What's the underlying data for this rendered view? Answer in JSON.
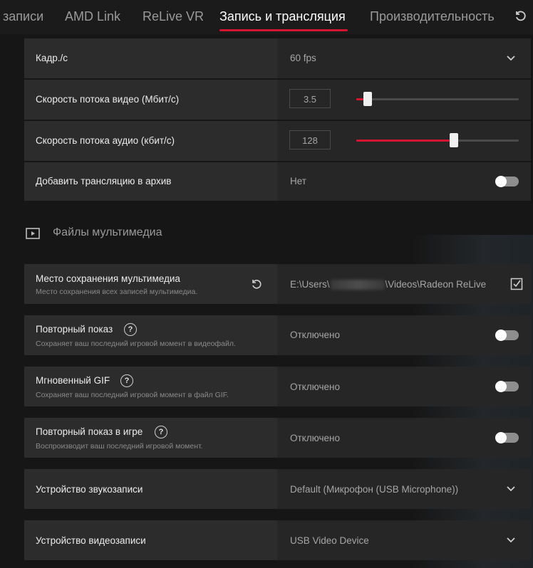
{
  "tabs": [
    {
      "label": "записи",
      "active": false
    },
    {
      "label": "AMD Link",
      "active": false
    },
    {
      "label": "ReLive VR",
      "active": false
    },
    {
      "label": "Запись и трансляция",
      "active": true
    },
    {
      "label": "Производительность",
      "active": false
    }
  ],
  "colors": {
    "accent": "#d5142f",
    "background": "#161616",
    "row_left": "#2c2c2c",
    "row_right": "#262626"
  },
  "rows": {
    "fps": {
      "label": "Кадр./с",
      "value": "60 fps"
    },
    "video_bitrate": {
      "label": "Скорость потока видео (Мбит/с)",
      "value": "3.5",
      "slider_fraction": 0.07
    },
    "audio_bitrate": {
      "label": "Скорость потока аудио (кбит/с)",
      "value": "128",
      "slider_fraction": 0.6
    },
    "archive": {
      "label": "Добавить трансляцию в архив",
      "value": "Нет",
      "enabled": false
    }
  },
  "media_section": {
    "title": "Файлы мультимедиа",
    "icon": "play-icon"
  },
  "media_rows": {
    "save_location": {
      "label": "Место сохранения мультимедиа",
      "sublabel": "Место сохранения всех записей мультимедиа.",
      "path_prefix": "E:\\Users\\",
      "path_suffix": "\\Videos\\Radeon ReLive"
    },
    "instant_replay": {
      "label": "Повторный показ",
      "sublabel": "Сохраняет ваш последний игровой момент в видеофайл.",
      "value": "Отключено",
      "enabled": false
    },
    "instant_gif": {
      "label": "Мгновенный GIF",
      "sublabel": "Сохраняет ваш последний игровой момент в файл GIF.",
      "value": "Отключено",
      "enabled": false
    },
    "in_game_replay": {
      "label": "Повторный показ в игре",
      "sublabel": "Воспроизводит ваш последний игровой момент.",
      "value": "Отключено",
      "enabled": false
    },
    "audio_device": {
      "label": "Устройство звукозаписи",
      "value": "Default (Микрофон (USB Microphone))"
    },
    "video_device": {
      "label": "Устройство видеозаписи",
      "value": "USB Video Device"
    }
  },
  "help_glyph": "?"
}
